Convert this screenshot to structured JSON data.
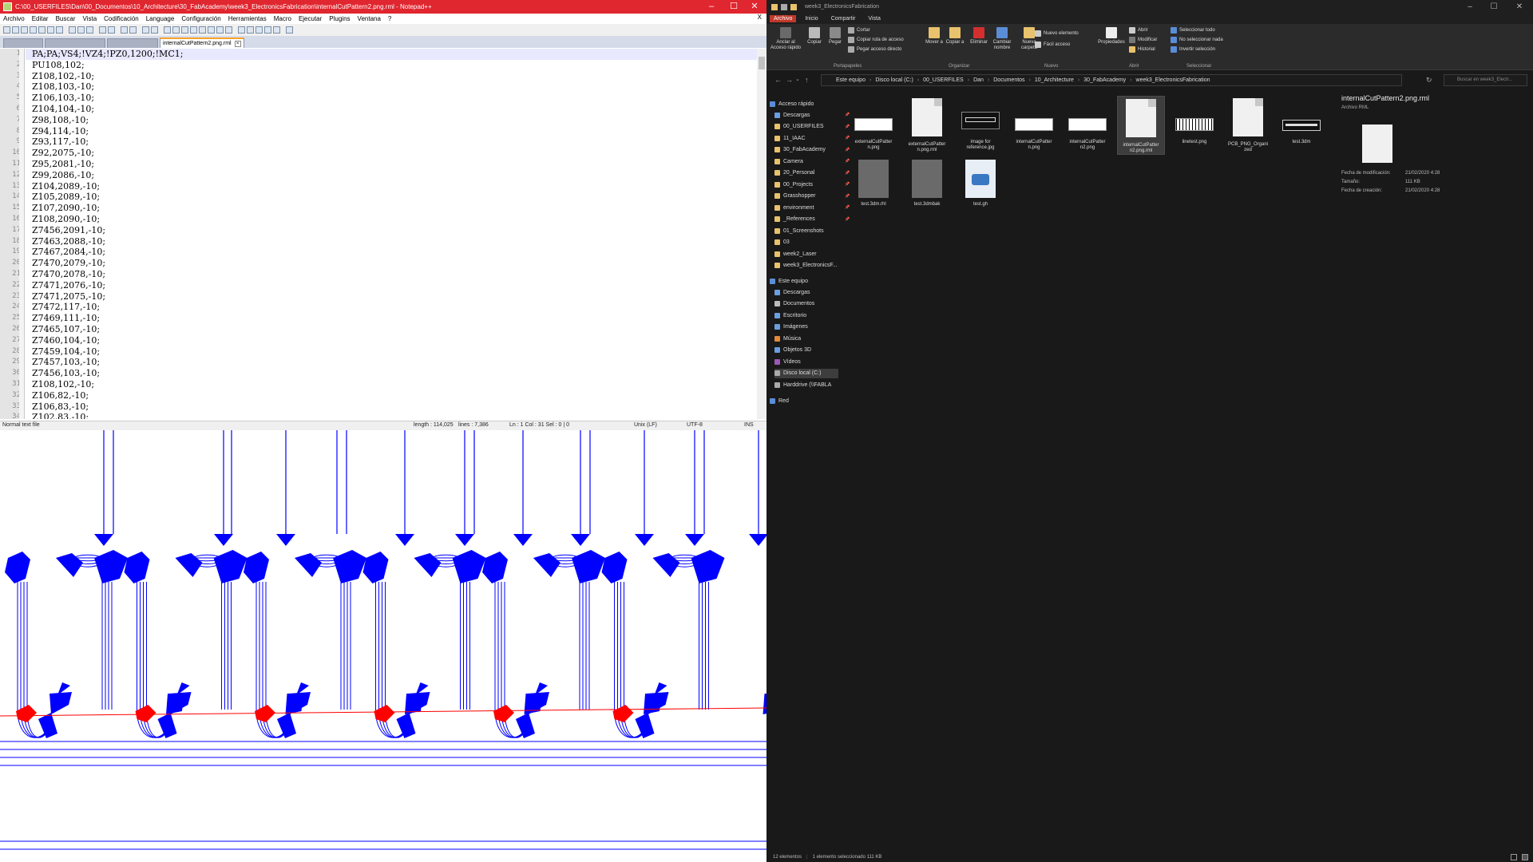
{
  "npp": {
    "title": "C:\\00_USERFILES\\Dan\\00_Documentos\\10_Architecture\\30_FabAcademy\\week3_ElectronicsFabrication\\internalCutPattern2.png.rml - Notepad++",
    "window_controls": {
      "min": "–",
      "max": "☐",
      "close": "✕"
    },
    "menu": [
      "Archivo",
      "Editar",
      "Buscar",
      "Vista",
      "Codificación",
      "Language",
      "Configuración",
      "Herramientas",
      "Macro",
      "Ejecutar",
      "Plugins",
      "Ventana",
      "?"
    ],
    "menu_close": "X",
    "tabs": [
      {
        "label": ""
      },
      {
        "label": ""
      },
      {
        "label": ""
      },
      {
        "label": "internalCutPattern2.png.rml"
      }
    ],
    "lines": [
      {
        "n": "1",
        "t": "PA;PA;VS4;!VZ4;!PZ0,1200;!MC1;"
      },
      {
        "n": "2",
        "t": "PU108,102;"
      },
      {
        "n": "3",
        "t": "Z108,102,-10;"
      },
      {
        "n": "4",
        "t": "Z108,103,-10;"
      },
      {
        "n": "5",
        "t": "Z106,103,-10;"
      },
      {
        "n": "6",
        "t": "Z104,104,-10;"
      },
      {
        "n": "7",
        "t": "Z98,108,-10;"
      },
      {
        "n": "8",
        "t": "Z94,114,-10;"
      },
      {
        "n": "9",
        "t": "Z93,117,-10;"
      },
      {
        "n": "10",
        "t": "Z92,2075,-10;"
      },
      {
        "n": "11",
        "t": "Z95,2081,-10;"
      },
      {
        "n": "12",
        "t": "Z99,2086,-10;"
      },
      {
        "n": "13",
        "t": "Z104,2089,-10;"
      },
      {
        "n": "14",
        "t": "Z105,2089,-10;"
      },
      {
        "n": "15",
        "t": "Z107,2090,-10;"
      },
      {
        "n": "16",
        "t": "Z108,2090,-10;"
      },
      {
        "n": "17",
        "t": "Z7456,2091,-10;"
      },
      {
        "n": "18",
        "t": "Z7463,2088,-10;"
      },
      {
        "n": "19",
        "t": "Z7467,2084,-10;"
      },
      {
        "n": "20",
        "t": "Z7470,2079,-10;"
      },
      {
        "n": "21",
        "t": "Z7470,2078,-10;"
      },
      {
        "n": "22",
        "t": "Z7471,2076,-10;"
      },
      {
        "n": "23",
        "t": "Z7471,2075,-10;"
      },
      {
        "n": "24",
        "t": "Z7472,117,-10;"
      },
      {
        "n": "25",
        "t": "Z7469,111,-10;"
      },
      {
        "n": "26",
        "t": "Z7465,107,-10;"
      },
      {
        "n": "27",
        "t": "Z7460,104,-10;"
      },
      {
        "n": "28",
        "t": "Z7459,104,-10;"
      },
      {
        "n": "29",
        "t": "Z7457,103,-10;"
      },
      {
        "n": "30",
        "t": "Z7456,103,-10;"
      },
      {
        "n": "31",
        "t": "Z108,102,-10;"
      },
      {
        "n": "32",
        "t": "Z106,82,-10;"
      },
      {
        "n": "33",
        "t": "Z106,83,-10;"
      },
      {
        "n": "34",
        "t": "Z102,83,-10;"
      }
    ],
    "status": {
      "type": "Normal text file",
      "length": "length : 114,025",
      "lines": "lines : 7,386",
      "pos": "Ln : 1    Col : 31    Sel : 0 | 0",
      "eol": "Unix (LF)",
      "enc": "UTF-8",
      "ins": "INS"
    },
    "colors": {
      "title_bar": "#e0262f",
      "trace": "#0000ff",
      "baseline": "#ff0000"
    }
  },
  "exp": {
    "title": "week3_ElectronicsFabrication",
    "window_controls": {
      "min": "–",
      "max": "☐",
      "close": "✕"
    },
    "ribbon_tabs": [
      "Archivo",
      "Inicio",
      "Compartir",
      "Vista"
    ],
    "ribbon": {
      "pin": "Anclar al Acceso rápido",
      "copy": "Copiar",
      "paste": "Pegar",
      "cut": "Cortar",
      "copy_path": "Copiar ruta de acceso",
      "paste_shortcut": "Pegar acceso directo",
      "move": "Mover a",
      "copy_to": "Copiar a",
      "delete": "Eliminar",
      "rename": "Cambiar nombre",
      "new_folder": "Nueva carpeta",
      "new_item": "Nuevo elemento",
      "easy_access": "Fácil acceso",
      "properties": "Propiedades",
      "open": "Abrir",
      "edit": "Modificar",
      "history": "Historial",
      "select_all": "Seleccionar todo",
      "select_none": "No seleccionar nada",
      "invert": "Invertir selección",
      "groups": [
        "Portapapeles",
        "Organizar",
        "Nuevo",
        "Abrir",
        "Seleccionar"
      ]
    },
    "breadcrumb": [
      "Este equipo",
      "Disco local (C:)",
      "00_USERFILES",
      "Dan",
      "Documentos",
      "10_Architecture",
      "30_FabAcademy",
      "week3_ElectronicsFabrication"
    ],
    "search_placeholder": "Buscar en week3_Electr...",
    "nav": {
      "quick_access": "Acceso rápido",
      "quick": [
        "Descargas",
        "00_USERFILES",
        "11_IAAC",
        "30_FabAcademy",
        "Camera",
        "20_Personal",
        "00_Projects",
        "Grasshopper",
        "environment",
        "_References",
        "01_Screenshots",
        "03",
        "week2_Laser",
        "week3_ElectronicsF..."
      ],
      "this_pc": "Este equipo",
      "pc": [
        "Descargas",
        "Documentos",
        "Escritorio",
        "Imágenes",
        "Música",
        "Objetos 3D",
        "Vídeos",
        "Disco local (C:)",
        "Harddrive (\\\\FABLA"
      ],
      "network": "Red"
    },
    "files": [
      {
        "name": "externalCutPatter n.png"
      },
      {
        "name": "externalCutPatter n.png.rml"
      },
      {
        "name": "image for reference.jpg"
      },
      {
        "name": "internalCutPatter n.png"
      },
      {
        "name": "internalCutPatter n2.png"
      },
      {
        "name": "internalCutPatter n2.png.rml"
      },
      {
        "name": "linetest.png"
      },
      {
        "name": "PCB_PNG_Organi zed"
      },
      {
        "name": "test.3dm"
      },
      {
        "name": "test.3dm.rhl"
      },
      {
        "name": "test.3dmbak"
      },
      {
        "name": "test.gh"
      }
    ],
    "preview": {
      "name": "internalCutPattern2.png.rml",
      "type": "Archivo RML",
      "modified_label": "Fecha de modificación:",
      "modified": "21/02/2020 4:28",
      "size_label": "Tamaño:",
      "size": "111 KB",
      "created_label": "Fecha de creación:",
      "created": "21/02/2020 4:28"
    },
    "status": {
      "count": "12 elementos",
      "selected": "1 elemento seleccionado  111 KB"
    }
  }
}
